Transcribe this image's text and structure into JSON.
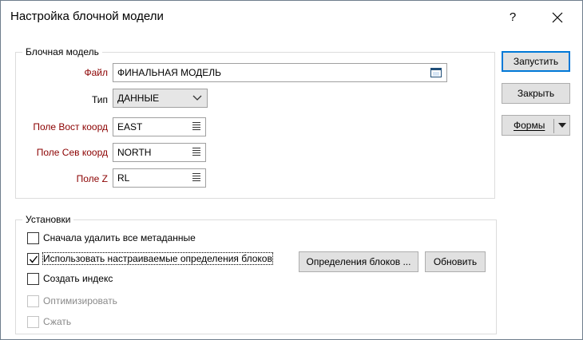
{
  "window": {
    "title": "Настройка блочной модели",
    "help_label": "?"
  },
  "block_model": {
    "group_title": "Блочная модель",
    "file_label": "Файл",
    "file_value": "ФИНАЛЬНАЯ МОДЕЛЬ",
    "type_label": "Тип",
    "type_value": "ДАННЫЕ",
    "east_label": "Поле Вост коорд",
    "east_value": "EAST",
    "north_label": "Поле Сев коорд",
    "north_value": "NORTH",
    "z_label": "Поле Z",
    "z_value": "RL"
  },
  "settings": {
    "group_title": "Установки",
    "delete_metadata_label": "Сначала удалить все метаданные",
    "delete_metadata_checked": false,
    "use_custom_defs_label": "Использовать настраиваемые определения блоков",
    "use_custom_defs_checked": true,
    "create_index_label": "Создать индекс",
    "create_index_checked": false,
    "optimize_label": "Оптимизировать",
    "optimize_enabled": false,
    "compress_label": "Сжать",
    "compress_enabled": false,
    "block_defs_button": "Определения блоков ...",
    "refresh_button": "Обновить"
  },
  "actions": {
    "run_label": "Запустить",
    "close_label": "Закрыть",
    "forms_label": "Формы"
  },
  "colors": {
    "required_label": "#8b0000",
    "default_button_border": "#0078d7"
  }
}
